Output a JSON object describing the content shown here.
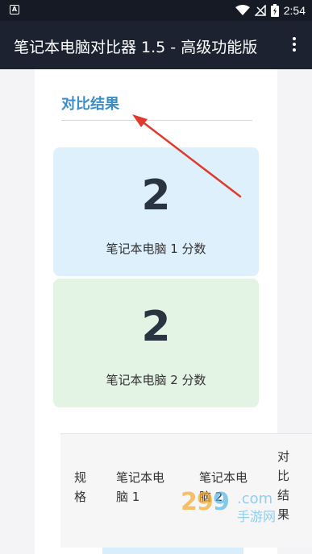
{
  "status_bar": {
    "notification_icon": "A",
    "time": "2:54"
  },
  "app_bar": {
    "title": "笔记本电脑对比器 1.5 - 高级功能版",
    "menu_icon": "more-vert-icon"
  },
  "result": {
    "section_title": "对比结果",
    "laptop1": {
      "score": "2",
      "label": "笔记本电脑 1 分数"
    },
    "laptop2": {
      "score": "2",
      "label": "笔记本电脑 2 分数"
    }
  },
  "table": {
    "headers": [
      "规格",
      "笔记本电脑 1",
      "笔记本电脑 2",
      "对比结果"
    ]
  },
  "watermark": {
    "text": "手游网"
  },
  "colors": {
    "status_bar": "#151a25",
    "app_bar": "#1c2230",
    "accent": "#3a8fc9",
    "score1_bg": "#ddf0fb",
    "score2_bg": "#e3f3e4",
    "annotation_arrow": "#e03a2c"
  }
}
